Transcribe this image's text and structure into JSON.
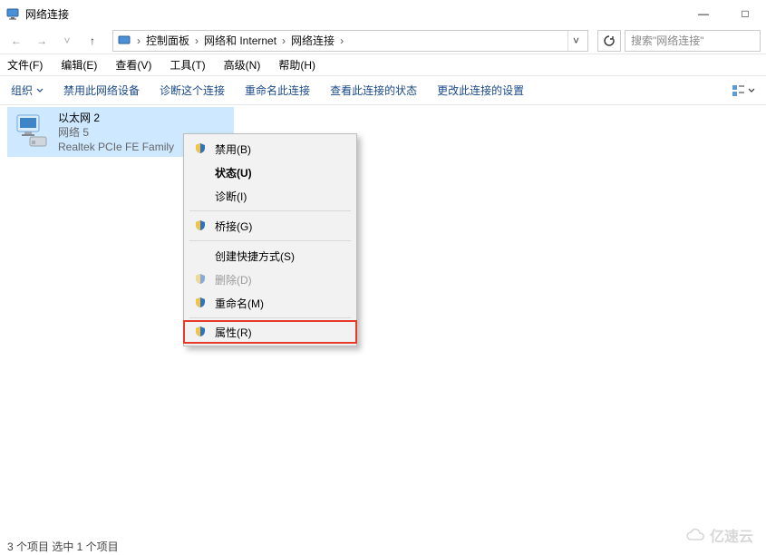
{
  "window": {
    "title": "网络连接"
  },
  "winbuttons": {
    "min": "—",
    "max": "□",
    "close": "✕"
  },
  "nav": {
    "back": "←",
    "forward": "→",
    "up": "↑",
    "refresh": "⟳",
    "dropdown": "˅"
  },
  "breadcrumbs": {
    "sep": "›",
    "items": [
      "控制面板",
      "网络和 Internet",
      "网络连接"
    ]
  },
  "search": {
    "placeholder": "搜索\"网络连接\""
  },
  "menubar": [
    "文件(F)",
    "编辑(E)",
    "查看(V)",
    "工具(T)",
    "高级(N)",
    "帮助(H)"
  ],
  "cmdbar": {
    "organize": "组织",
    "disable": "禁用此网络设备",
    "diagnose": "诊断这个连接",
    "rename": "重命名此连接",
    "status": "查看此连接的状态",
    "change": "更改此连接的设置"
  },
  "adapter": {
    "name": "以太网 2",
    "network": "网络 5",
    "device": "Realtek PCIe FE Family"
  },
  "ctxmenu": {
    "disable": "禁用(B)",
    "status": "状态(U)",
    "diagnose": "诊断(I)",
    "bridge": "桥接(G)",
    "shortcut": "创建快捷方式(S)",
    "delete": "删除(D)",
    "rename": "重命名(M)",
    "properties": "属性(R)"
  },
  "statusbar": "3 个项目    选中 1 个项目",
  "watermark": "亿速云"
}
